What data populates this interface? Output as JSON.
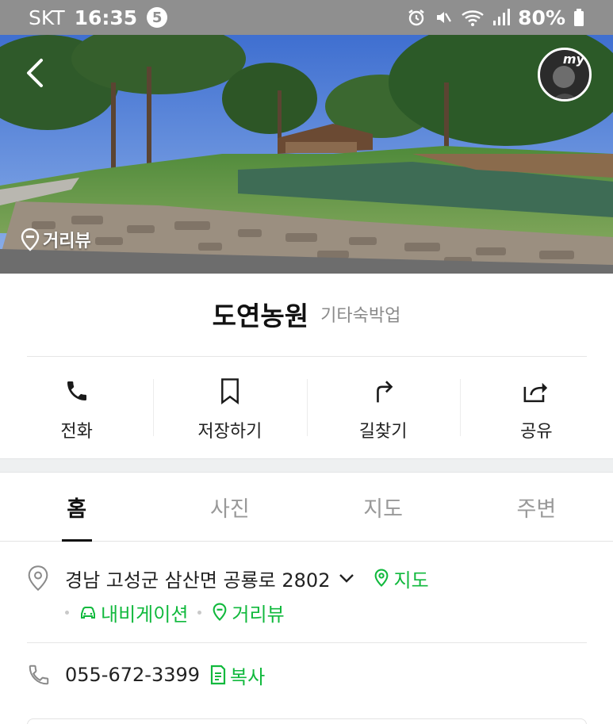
{
  "status_bar": {
    "carrier": "SKT",
    "time": "16:35",
    "notification_count": "5",
    "battery": "80%",
    "icons": [
      "alarm-icon",
      "mute-icon",
      "wifi-icon",
      "signal-icon",
      "battery-icon"
    ]
  },
  "hero": {
    "street_view_label": "거리뷰",
    "avatar_text": "my"
  },
  "place": {
    "name": "도연농원",
    "category": "기타숙박업"
  },
  "actions": [
    {
      "icon": "phone-icon",
      "label": "전화"
    },
    {
      "icon": "bookmark-icon",
      "label": "저장하기"
    },
    {
      "icon": "directions-icon",
      "label": "길찾기"
    },
    {
      "icon": "share-icon",
      "label": "공유"
    }
  ],
  "tabs": [
    {
      "label": "홈",
      "active": true
    },
    {
      "label": "사진",
      "active": false
    },
    {
      "label": "지도",
      "active": false
    },
    {
      "label": "주변",
      "active": false
    }
  ],
  "address": {
    "text": "경남 고성군 삼산면 공룡로 2802",
    "map_link": "지도",
    "navigation_link": "내비게이션",
    "street_view_link": "거리뷰"
  },
  "phone": {
    "number": "055-672-3399",
    "copy_label": "복사"
  },
  "colors": {
    "accent_green": "#11b93d",
    "status_bar": "#8f8f8f"
  }
}
